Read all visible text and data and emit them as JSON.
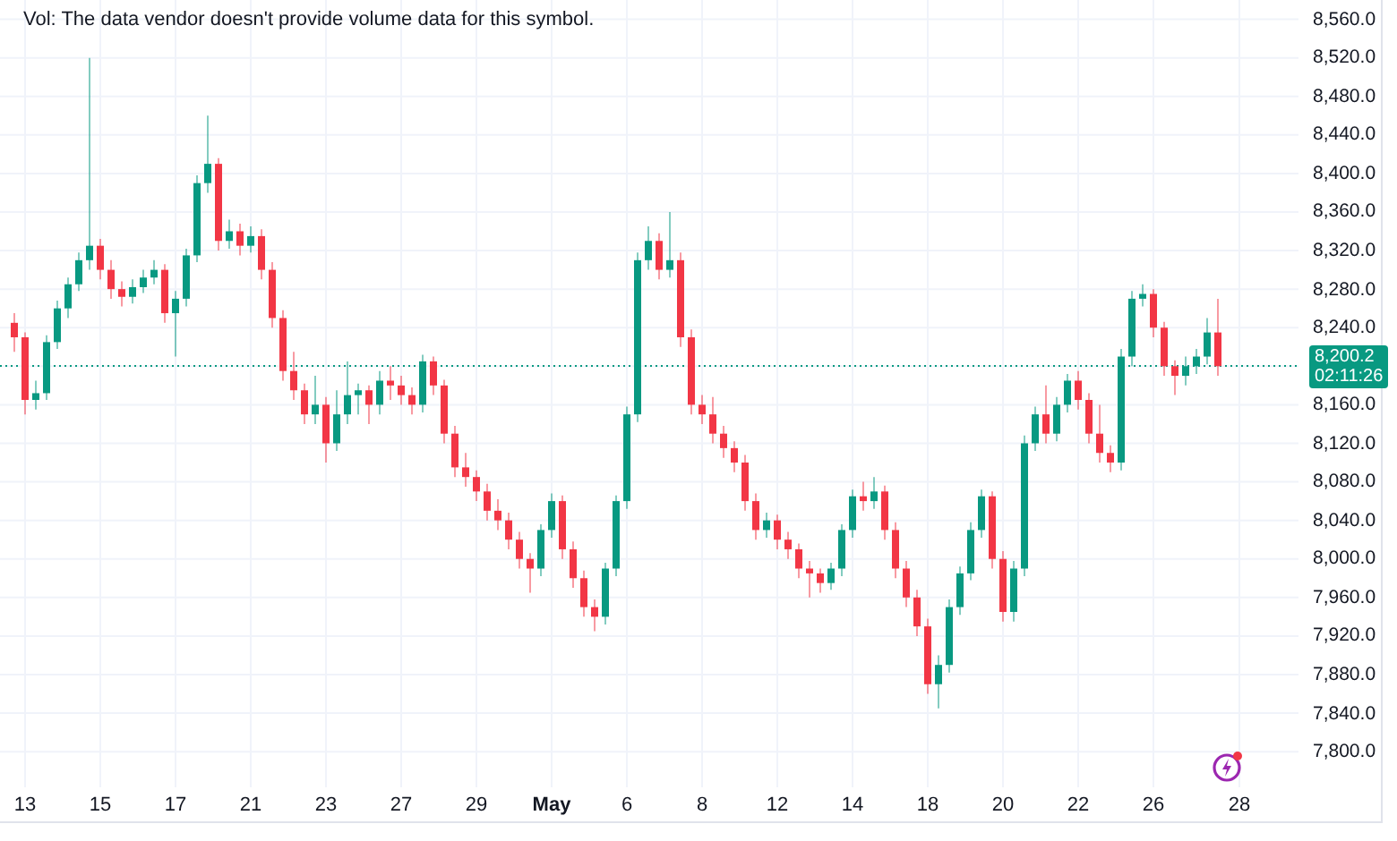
{
  "legend": {
    "volume_note": "Vol: The data vendor doesn't provide volume data for this symbol."
  },
  "last_price": {
    "price": "8,200.2",
    "countdown": "02:11:26"
  },
  "chart_data": {
    "type": "candlestick",
    "yticks": [
      {
        "value": 8560,
        "label": "8,560.0"
      },
      {
        "value": 8520,
        "label": "8,520.0"
      },
      {
        "value": 8480,
        "label": "8,480.0"
      },
      {
        "value": 8440,
        "label": "8,440.0"
      },
      {
        "value": 8400,
        "label": "8,400.0"
      },
      {
        "value": 8360,
        "label": "8,360.0"
      },
      {
        "value": 8320,
        "label": "8,320.0"
      },
      {
        "value": 8280,
        "label": "8,280.0"
      },
      {
        "value": 8240,
        "label": "8,240.0"
      },
      {
        "value": 8160,
        "label": "8,160.0"
      },
      {
        "value": 8120,
        "label": "8,120.0"
      },
      {
        "value": 8080,
        "label": "8,080.0"
      },
      {
        "value": 8040,
        "label": "8,040.0"
      },
      {
        "value": 8000,
        "label": "8,000.0"
      },
      {
        "value": 7960,
        "label": "7,960.0"
      },
      {
        "value": 7920,
        "label": "7,920.0"
      },
      {
        "value": 7880,
        "label": "7,880.0"
      },
      {
        "value": 7840,
        "label": "7,840.0"
      },
      {
        "value": 7800,
        "label": "7,800.0"
      }
    ],
    "ylim": [
      7763,
      8580
    ],
    "grid": true,
    "ref_lines": [
      {
        "axis": "y",
        "value": 8200.2,
        "color": "#089981"
      }
    ],
    "categories": [
      null,
      "13",
      null,
      null,
      null,
      null,
      null,
      null,
      "15",
      null,
      null,
      null,
      null,
      null,
      null,
      "17",
      null,
      null,
      null,
      null,
      null,
      null,
      "21",
      null,
      null,
      null,
      null,
      null,
      null,
      "23",
      null,
      null,
      null,
      null,
      null,
      null,
      "27",
      null,
      null,
      null,
      null,
      null,
      null,
      "29",
      null,
      null,
      null,
      null,
      null,
      null,
      "May",
      null,
      null,
      null,
      null,
      null,
      null,
      "6",
      null,
      null,
      null,
      null,
      null,
      null,
      "8",
      null,
      null,
      null,
      null,
      null,
      null,
      "12",
      null,
      null,
      null,
      null,
      null,
      null,
      "14",
      null,
      null,
      null,
      null,
      null,
      null,
      "18",
      null,
      null,
      null,
      null,
      null,
      null,
      "20",
      null,
      null,
      null,
      null,
      null,
      null,
      "22",
      null,
      null,
      null,
      null,
      null,
      null,
      "26",
      null,
      null,
      null,
      null,
      null,
      null,
      null,
      "28"
    ],
    "ohlc": [
      [
        8245,
        8255,
        8215,
        8230
      ],
      [
        8230,
        8235,
        8150,
        8165
      ],
      [
        8165,
        8185,
        8155,
        8172
      ],
      [
        8172,
        8232,
        8165,
        8225
      ],
      [
        8225,
        8268,
        8218,
        8260
      ],
      [
        8260,
        8292,
        8250,
        8285
      ],
      [
        8285,
        8318,
        8278,
        8310
      ],
      [
        8310,
        8520,
        8300,
        8325
      ],
      [
        8325,
        8332,
        8290,
        8300
      ],
      [
        8300,
        8310,
        8270,
        8280
      ],
      [
        8280,
        8288,
        8262,
        8272
      ],
      [
        8272,
        8290,
        8265,
        8282
      ],
      [
        8282,
        8300,
        8276,
        8292
      ],
      [
        8292,
        8310,
        8285,
        8300
      ],
      [
        8300,
        8306,
        8245,
        8255
      ],
      [
        8255,
        8278,
        8210,
        8270
      ],
      [
        8270,
        8322,
        8262,
        8315
      ],
      [
        8315,
        8398,
        8308,
        8390
      ],
      [
        8390,
        8460,
        8380,
        8410
      ],
      [
        8410,
        8416,
        8320,
        8330
      ],
      [
        8330,
        8352,
        8322,
        8340
      ],
      [
        8340,
        8348,
        8315,
        8325
      ],
      [
        8325,
        8345,
        8318,
        8335
      ],
      [
        8335,
        8342,
        8290,
        8300
      ],
      [
        8300,
        8308,
        8240,
        8250
      ],
      [
        8250,
        8258,
        8185,
        8195
      ],
      [
        8195,
        8215,
        8165,
        8175
      ],
      [
        8175,
        8182,
        8140,
        8150
      ],
      [
        8150,
        8190,
        8140,
        8160
      ],
      [
        8160,
        8168,
        8100,
        8120
      ],
      [
        8120,
        8175,
        8112,
        8150
      ],
      [
        8150,
        8205,
        8140,
        8170
      ],
      [
        8170,
        8182,
        8150,
        8175
      ],
      [
        8175,
        8180,
        8140,
        8160
      ],
      [
        8160,
        8195,
        8150,
        8185
      ],
      [
        8185,
        8200,
        8165,
        8180
      ],
      [
        8180,
        8190,
        8160,
        8170
      ],
      [
        8170,
        8178,
        8150,
        8160
      ],
      [
        8160,
        8212,
        8152,
        8205
      ],
      [
        8205,
        8210,
        8170,
        8180
      ],
      [
        8180,
        8186,
        8120,
        8130
      ],
      [
        8130,
        8138,
        8085,
        8095
      ],
      [
        8095,
        8110,
        8075,
        8085
      ],
      [
        8085,
        8092,
        8060,
        8070
      ],
      [
        8070,
        8078,
        8040,
        8050
      ],
      [
        8050,
        8062,
        8030,
        8040
      ],
      [
        8040,
        8048,
        8010,
        8020
      ],
      [
        8020,
        8028,
        7990,
        8000
      ],
      [
        8000,
        8006,
        7965,
        7990
      ],
      [
        7990,
        8036,
        7982,
        8030
      ],
      [
        8030,
        8068,
        8022,
        8060
      ],
      [
        8060,
        8066,
        8000,
        8010
      ],
      [
        8010,
        8018,
        7970,
        7980
      ],
      [
        7980,
        7988,
        7940,
        7950
      ],
      [
        7950,
        7958,
        7925,
        7940
      ],
      [
        7940,
        7996,
        7932,
        7990
      ],
      [
        7990,
        8066,
        7982,
        8060
      ],
      [
        8060,
        8158,
        8052,
        8150
      ],
      [
        8150,
        8318,
        8142,
        8310
      ],
      [
        8310,
        8345,
        8300,
        8330
      ],
      [
        8330,
        8338,
        8290,
        8300
      ],
      [
        8300,
        8360,
        8292,
        8310
      ],
      [
        8310,
        8318,
        8220,
        8230
      ],
      [
        8230,
        8238,
        8150,
        8160
      ],
      [
        8160,
        8170,
        8140,
        8150
      ],
      [
        8150,
        8168,
        8120,
        8130
      ],
      [
        8130,
        8138,
        8105,
        8115
      ],
      [
        8115,
        8122,
        8090,
        8100
      ],
      [
        8100,
        8108,
        8050,
        8060
      ],
      [
        8060,
        8068,
        8020,
        8030
      ],
      [
        8030,
        8048,
        8022,
        8040
      ],
      [
        8040,
        8046,
        8010,
        8020
      ],
      [
        8020,
        8028,
        8000,
        8010
      ],
      [
        8010,
        8016,
        7980,
        7990
      ],
      [
        7990,
        7998,
        7960,
        7985
      ],
      [
        7985,
        7990,
        7965,
        7975
      ],
      [
        7975,
        7996,
        7968,
        7990
      ],
      [
        7990,
        8036,
        7982,
        8030
      ],
      [
        8030,
        8072,
        8022,
        8065
      ],
      [
        8065,
        8080,
        8050,
        8060
      ],
      [
        8060,
        8085,
        8052,
        8070
      ],
      [
        8070,
        8076,
        8020,
        8030
      ],
      [
        8030,
        8038,
        7980,
        7990
      ],
      [
        7990,
        7998,
        7950,
        7960
      ],
      [
        7960,
        7968,
        7920,
        7930
      ],
      [
        7930,
        7938,
        7860,
        7870
      ],
      [
        7870,
        7900,
        7845,
        7890
      ],
      [
        7890,
        7958,
        7882,
        7950
      ],
      [
        7950,
        7992,
        7942,
        7985
      ],
      [
        7985,
        8038,
        7978,
        8030
      ],
      [
        8030,
        8072,
        8022,
        8065
      ],
      [
        8065,
        8070,
        7990,
        8000
      ],
      [
        8000,
        8008,
        7935,
        7945
      ],
      [
        7945,
        7998,
        7935,
        7990
      ],
      [
        7990,
        8128,
        7982,
        8120
      ],
      [
        8120,
        8158,
        8112,
        8150
      ],
      [
        8150,
        8180,
        8120,
        8130
      ],
      [
        8130,
        8168,
        8122,
        8160
      ],
      [
        8160,
        8192,
        8152,
        8185
      ],
      [
        8185,
        8195,
        8155,
        8165
      ],
      [
        8165,
        8172,
        8120,
        8130
      ],
      [
        8130,
        8160,
        8100,
        8110
      ],
      [
        8110,
        8118,
        8090,
        8100
      ],
      [
        8100,
        8218,
        8092,
        8210
      ],
      [
        8210,
        8278,
        8200,
        8270
      ],
      [
        8270,
        8285,
        8262,
        8275
      ],
      [
        8275,
        8280,
        8230,
        8240
      ],
      [
        8240,
        8246,
        8190,
        8200
      ],
      [
        8200,
        8206,
        8170,
        8190
      ],
      [
        8190,
        8210,
        8180,
        8200
      ],
      [
        8200,
        8218,
        8192,
        8210
      ],
      [
        8210,
        8250,
        8202,
        8235
      ],
      [
        8235,
        8270,
        8190,
        8200
      ],
      null,
      null
    ]
  }
}
